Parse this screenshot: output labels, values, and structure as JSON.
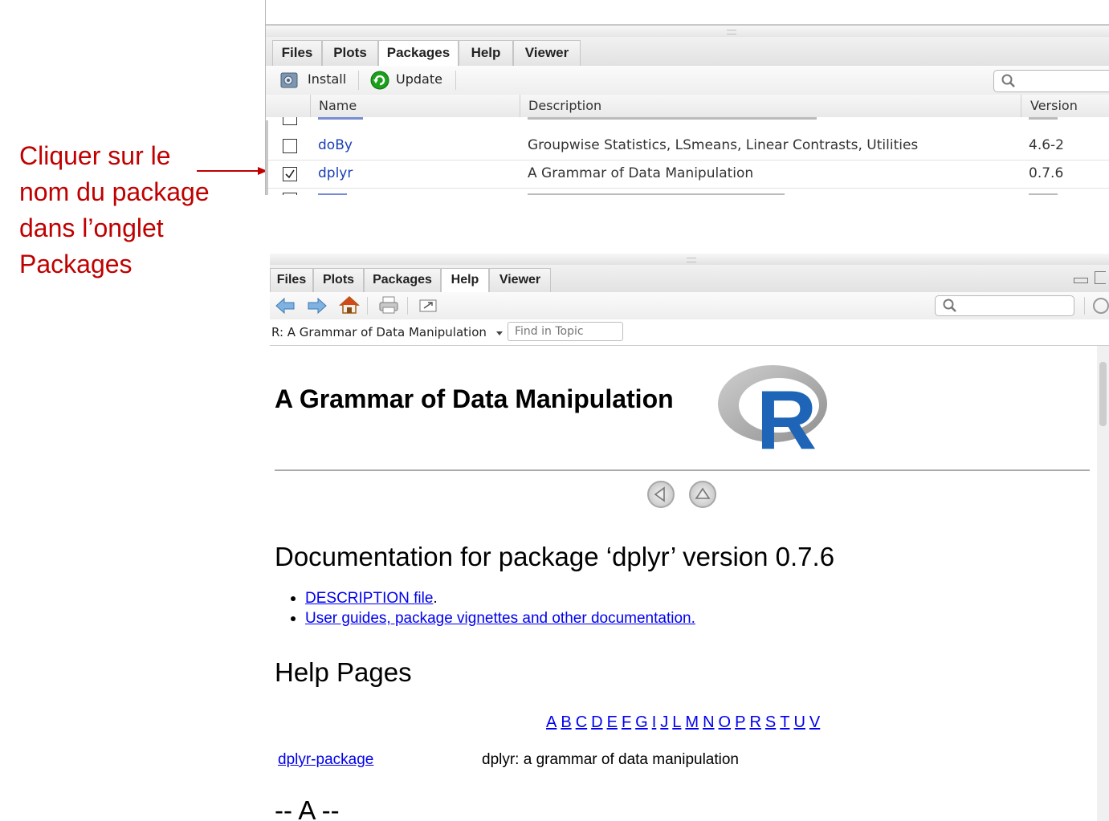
{
  "annotation": {
    "lines": [
      "Cliquer sur le",
      "nom du package",
      "dans l’onglet",
      "Packages"
    ],
    "color": "#c00000"
  },
  "packages_pane": {
    "tabs": [
      "Files",
      "Plots",
      "Packages",
      "Help",
      "Viewer"
    ],
    "active_tab": "Packages",
    "toolbar": {
      "install_label": "Install",
      "update_label": "Update"
    },
    "columns": {
      "name": "Name",
      "description": "Description",
      "version": "Version"
    },
    "rows": [
      {
        "checked": false,
        "name": "doBy",
        "description": "Groupwise Statistics, LSmeans, Linear Contrasts, Utilities",
        "version": "4.6-2"
      },
      {
        "checked": true,
        "name": "dplyr",
        "description": "A Grammar of Data Manipulation",
        "version": "0.7.6"
      }
    ]
  },
  "help_pane": {
    "tabs": [
      "Files",
      "Plots",
      "Packages",
      "Help",
      "Viewer"
    ],
    "active_tab": "Help",
    "topic_selector": "R: A Grammar of Data Manipulation",
    "find_placeholder": "Find in Topic",
    "doc": {
      "title": "A Grammar of Data Manipulation",
      "logo_letter": "R",
      "heading_doc": "Documentation for package ‘dplyr’ version 0.7.6",
      "links": [
        "DESCRIPTION file",
        "User guides, package vignettes and other documentation."
      ],
      "link_1_suffix": ".",
      "heading_help": "Help Pages",
      "alphabet": [
        "A",
        "B",
        "C",
        "D",
        "E",
        "F",
        "G",
        "I",
        "J",
        "L",
        "M",
        "N",
        "O",
        "P",
        "R",
        "S",
        "T",
        "U",
        "V"
      ],
      "entry": {
        "link": "dplyr-package",
        "text": "dplyr: a grammar of data manipulation"
      },
      "section_a": "-- A --"
    }
  },
  "colors": {
    "link": "#0000ee",
    "package_name": "#1a3fb5",
    "r_logo_blue": "#1f65b7"
  }
}
